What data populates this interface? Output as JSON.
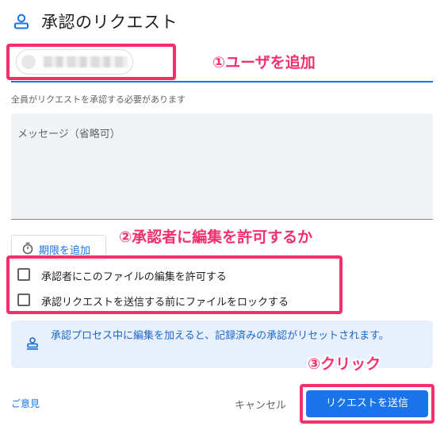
{
  "dialog": {
    "title": "承認のリクエスト",
    "title_icon": "approval-person-icon"
  },
  "user_field": {
    "chip_avatar_icon": "avatar-icon",
    "helper_text": "全員がリクエストを承認する必要があります"
  },
  "message": {
    "placeholder": "メッセージ（省略可）"
  },
  "deadline": {
    "icon": "timer-icon",
    "label": "期限を追加"
  },
  "options": [
    {
      "label": "承認者にこのファイルの編集を許可する",
      "checked": false
    },
    {
      "label": "承認リクエストを送信する前にファイルをロックする",
      "checked": false
    }
  ],
  "info": {
    "icon": "approval-stamp-icon",
    "text": "承認プロセス中に編集を加えると、記録済みの承認がリセットされます。"
  },
  "footer": {
    "feedback": "ご意見",
    "cancel": "キャンセル",
    "send": "リクエストを送信"
  },
  "annotations": {
    "step1": "①ユーザを追加",
    "step2": "②承認者に編集を許可するか",
    "step3": "③クリック"
  },
  "colors": {
    "accent": "#1a73e8",
    "highlight": "#f3306d",
    "info_bg": "#e8f0fe"
  }
}
